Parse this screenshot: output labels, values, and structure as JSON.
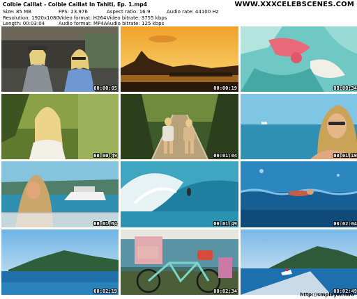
{
  "header": {
    "title": "Colbie Caillat - Colbie Caillat In Tahiti, Ep. 1.mp4",
    "brand": "WWW.XXXCELEBSCENES.COM"
  },
  "info_rows": [
    [
      "Size: 85 MB",
      "FPS: 23.976",
      "Aspect ratio: 16:9",
      "Audio rate: 44100 Hz"
    ],
    [
      "Resolution: 1920x1080",
      "Video format: H264",
      "Video bitrate: 3755 kbps",
      ""
    ],
    [
      "Length: 00:03:04",
      "Audio format: MP4A",
      "Audio bitrate: 125 kbps",
      ""
    ]
  ],
  "thumbnails": [
    {
      "timestamp": "00:00:05"
    },
    {
      "timestamp": "00:00:19"
    },
    {
      "timestamp": "00:00:34"
    },
    {
      "timestamp": "00:00:49"
    },
    {
      "timestamp": "00:01:04"
    },
    {
      "timestamp": "00:01:19"
    },
    {
      "timestamp": "00:01:34"
    },
    {
      "timestamp": "00:01:49"
    },
    {
      "timestamp": "00:02:04"
    },
    {
      "timestamp": "00:02:19"
    },
    {
      "timestamp": "00:02:34"
    },
    {
      "timestamp": "00:02:49"
    }
  ],
  "footer": {
    "url": "http://smplayer.info"
  }
}
